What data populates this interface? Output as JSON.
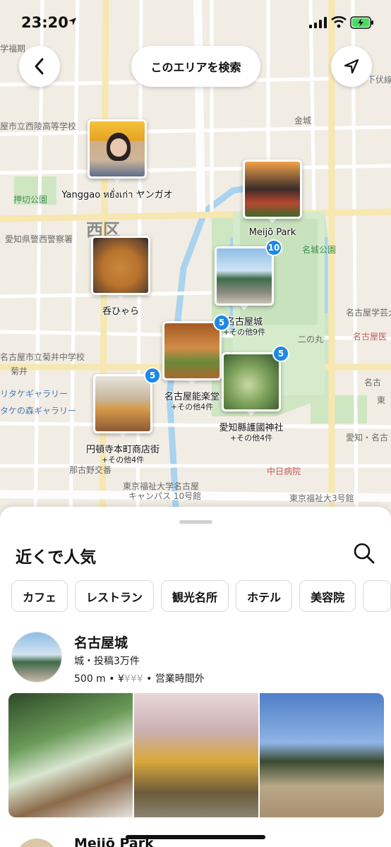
{
  "status_bar": {
    "time": "23:20"
  },
  "header": {
    "search_area_label": "このエリアを検索"
  },
  "map": {
    "labels": {
      "ward": "西区",
      "park1": "押切公園",
      "police": "愛知県警西警察署",
      "school1": "屋市立西陵高等学校",
      "kanejo": "金城",
      "meijo_koen": "名城公園",
      "ninomaru": "二の丸",
      "museum": "名古屋学芸大",
      "hospital": "名古屋医",
      "kikui_school": "名古屋市立菊井中学校",
      "kikui": "菊井",
      "gallery1": "リタケギャラリー",
      "gallery2": "タケの森ギャラリー",
      "nagoya_r": "名古",
      "higashi": "東",
      "post": "那古野交番",
      "chunichi": "中日病院",
      "fukushi": "東京福祉大学名古屋",
      "fukushi2": "キャンパス 10号館",
      "fukushi3": "東京福祉大3号館",
      "aichi": "愛知・名古",
      "top_school": "学福期",
      "top_road": "下伏線"
    },
    "pins": [
      {
        "title": "Yanggao หยั่งเก่า ヤンガオ",
        "sub": "",
        "badge": ""
      },
      {
        "title": "Meijō Park",
        "sub": "",
        "badge": ""
      },
      {
        "title": "呑ひゃら",
        "sub": "",
        "badge": ""
      },
      {
        "title": "名古屋城",
        "sub": "+その他9件",
        "badge": "10"
      },
      {
        "title": "名古屋能楽堂",
        "sub": "+その他4件",
        "badge": "5"
      },
      {
        "title": "愛知縣護國神社",
        "sub": "+その他4件",
        "badge": "5"
      },
      {
        "title": "円頓寺本町商店街",
        "sub": "+その他4件",
        "badge": "5"
      }
    ]
  },
  "sheet": {
    "title": "近くで人気",
    "chips": [
      "カフェ",
      "レストラン",
      "観光名所",
      "ホテル",
      "美容院"
    ],
    "places": [
      {
        "name": "名古屋城",
        "category_line": "城・投稿3万件",
        "distance": "500 m",
        "price_active": "¥",
        "price_inactive": "¥¥¥",
        "hours": "営業時間外"
      }
    ],
    "next_place_name": "Meijō Park"
  },
  "colors": {
    "accent": "#1e88e5",
    "map_bg": "#f1ede4",
    "park": "#cfe6c3",
    "water": "#a9d3ef"
  }
}
